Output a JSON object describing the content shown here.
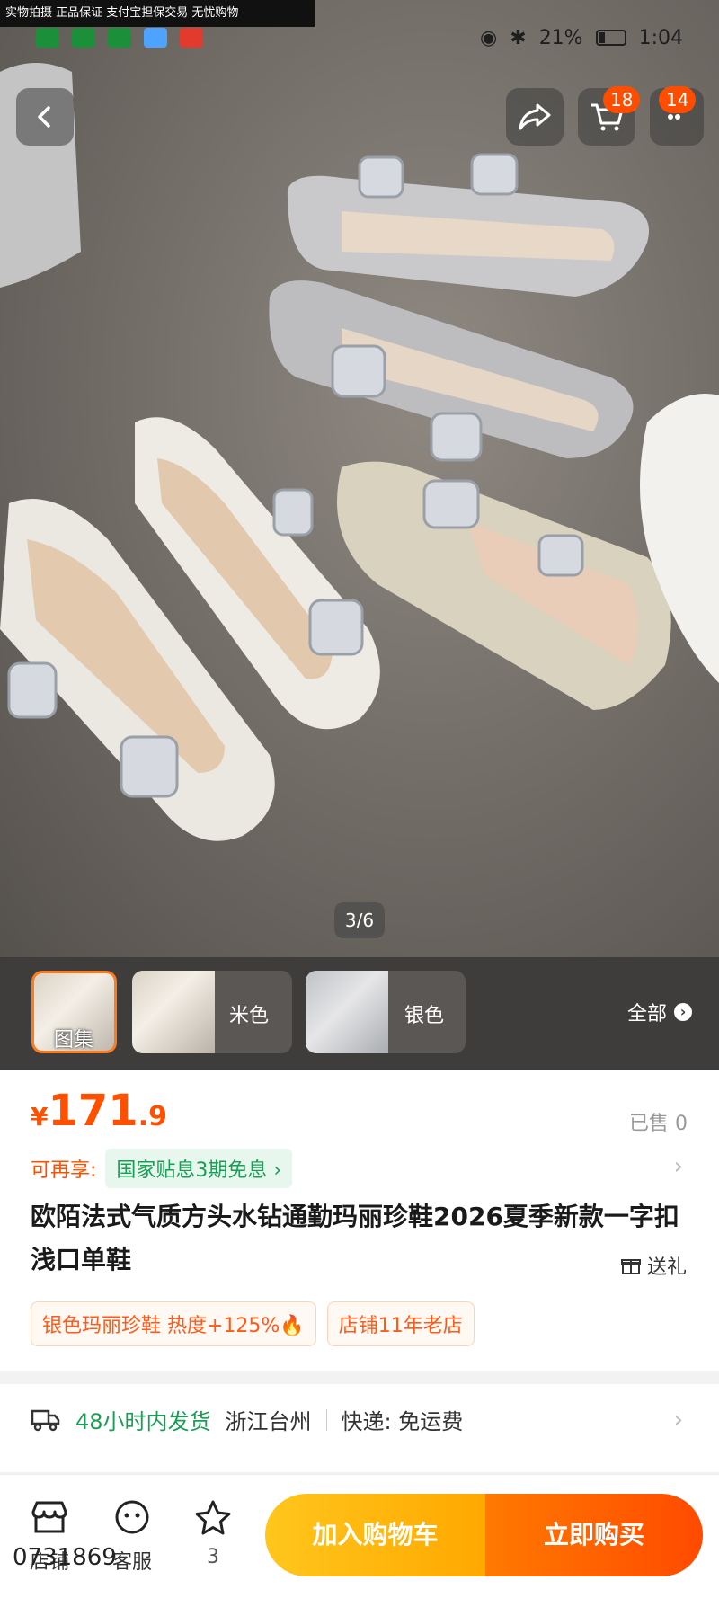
{
  "top_strip": "实物拍摄 正品保证 支付宝担保交易 无忧购物",
  "status": {
    "battery": "21%",
    "time": "1:04"
  },
  "nav": {
    "cart_badge": "18",
    "msg_badge": "14"
  },
  "image_counter": "3/6",
  "thumbs": [
    {
      "label": "图集"
    },
    {
      "label": "米色"
    },
    {
      "label": "银色"
    }
  ],
  "all_label": "全部",
  "price": {
    "symbol": "¥",
    "int": "171",
    "dec": ".9"
  },
  "sold": "已售 0",
  "promo": {
    "prefix": "可再享:",
    "chip": "国家贴息3期免息 ›"
  },
  "title": "欧陌法式气质方头水钻通勤玛丽珍鞋2026夏季新款一字扣浅口单鞋",
  "gift": "送礼",
  "tags": [
    "银色玛丽珍鞋 热度+125%🔥",
    "店铺11年老店"
  ],
  "shipping": {
    "time": "48小时内发货",
    "origin": "浙江台州",
    "fee": "快递: 免运费"
  },
  "bottom": {
    "shop": "店铺",
    "service": "客服",
    "fav_count": "3",
    "cart_button": "加入购物车",
    "buy_button": "立即购买",
    "phone_fragment": "0731869"
  },
  "colors": {
    "accent": "#ff5000",
    "green": "#1a9e55"
  }
}
